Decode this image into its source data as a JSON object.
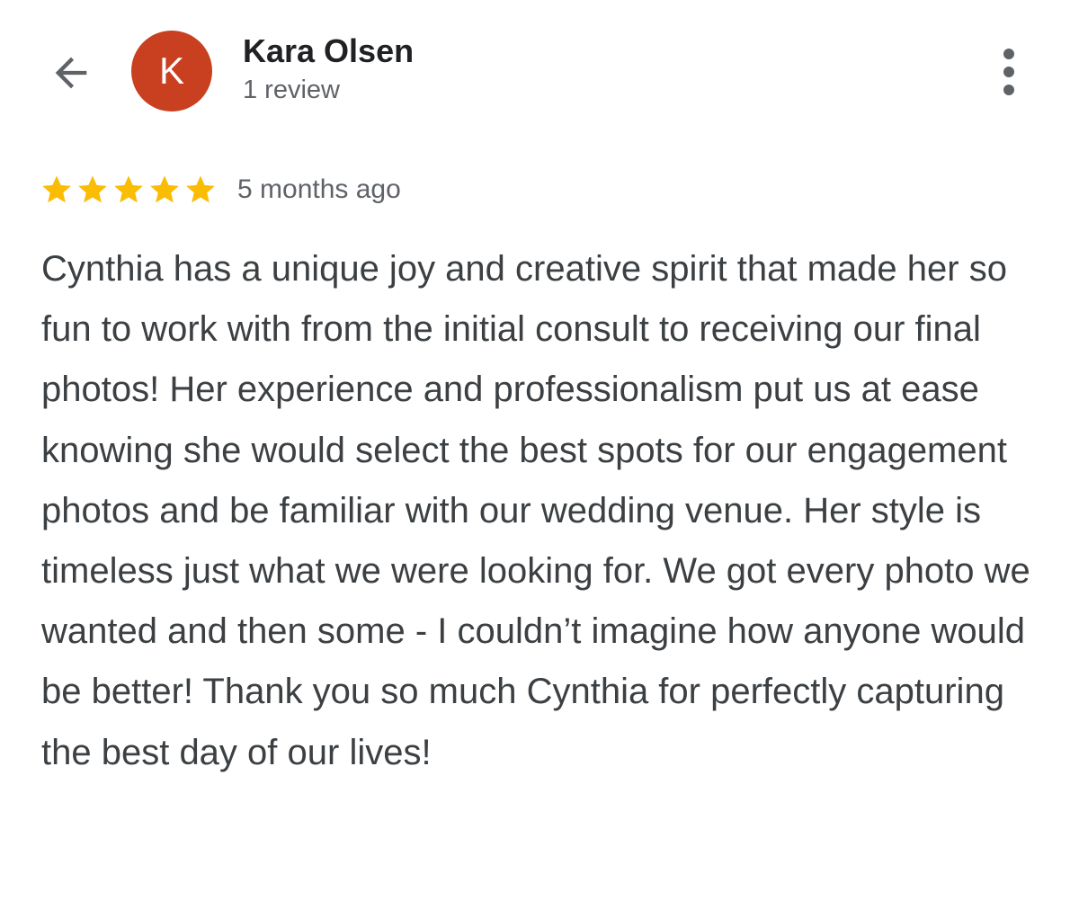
{
  "header": {
    "back_icon": "arrow-left-icon",
    "avatar_letter": "K",
    "avatar_color": "#c8401f",
    "reviewer_name": "Kara Olsen",
    "review_count": "1 review",
    "more_icon": "more-vertical-icon"
  },
  "review": {
    "rating": 5,
    "rating_max": 5,
    "star_color": "#fbbc04",
    "star_icon": "star-icon",
    "time_ago": "5 months ago",
    "text": "Cynthia has a unique joy and creative spirit that made her so fun to work with from the initial consult to receiving our final photos! Her experience and professionalism put us at ease knowing she would select the best spots for our engagement photos and be familiar with our wedding venue. Her style is timeless just what we were looking for. We got every photo we wanted and then some - I couldn’t imagine how anyone would be better! Thank you so much Cynthia for perfectly capturing the best day of our lives!"
  }
}
